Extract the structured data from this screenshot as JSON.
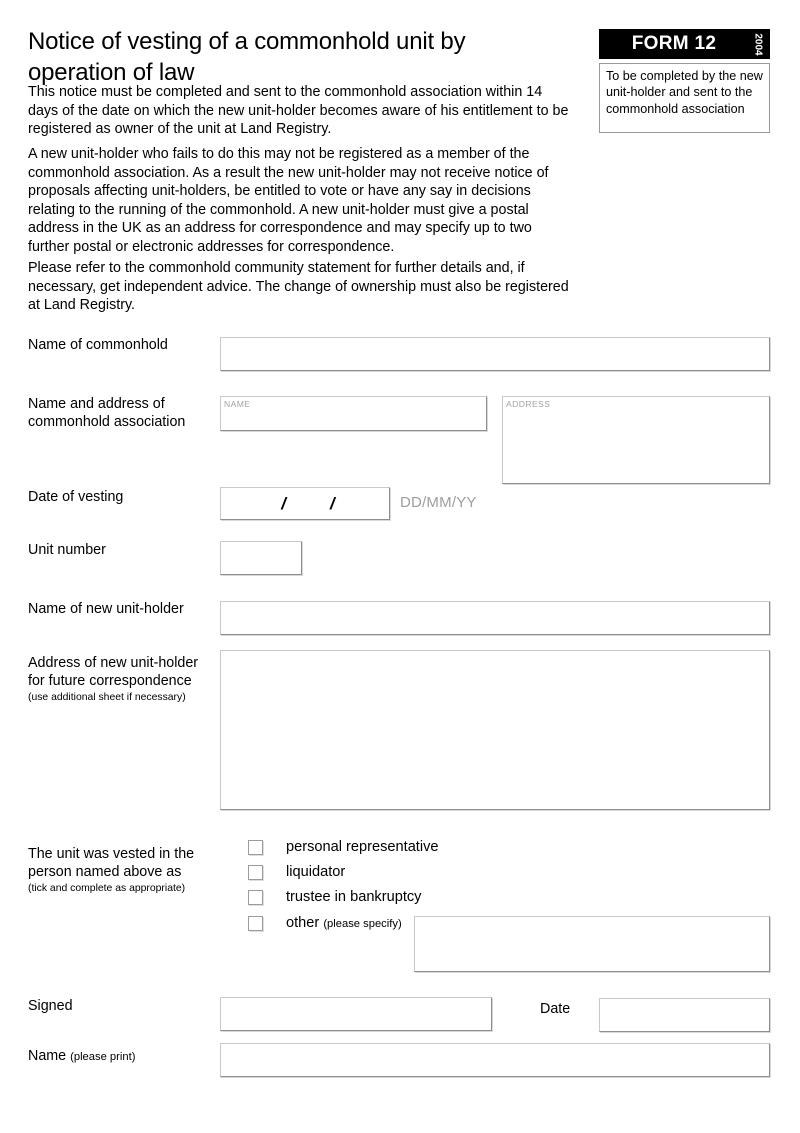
{
  "document": {
    "title": "Notice of vesting of a commonhold unit by operation of law",
    "paragraphs": [
      "This notice must be completed and sent to the commonhold association within 14 days of the date on which the new unit-holder becomes aware of his entitlement to be registered as owner of the unit at Land Registry.",
      "A new unit-holder who fails to do this may not be registered as a member of the commonhold association. As a result the new unit-holder may not receive notice of proposals affecting unit-holders, be entitled to vote or have any say in decisions relating to the running of the commonhold.  A new unit-holder must give a postal address in the UK as an address for correspondence and may specify up to two further postal or electronic addresses for correspondence.",
      "Please refer to the commonhold community statement for further details and, if necessary, get independent advice. The change of ownership must also be registered at Land Registry."
    ]
  },
  "badge": {
    "form_label": "FORM 12",
    "year": "2004",
    "note": "To be completed by the new unit-holder and sent to the commonhold association",
    "background_color": "#000000",
    "text_color": "#ffffff"
  },
  "fields": {
    "commonhold_name": {
      "label": "Name of commonhold",
      "value": ""
    },
    "association": {
      "label": "Name and address of commonhold association",
      "name_placeholder": "NAME",
      "name_value": "",
      "address_placeholder": "ADDRESS",
      "address_value": ""
    },
    "date_of_vesting": {
      "label": "Date of vesting",
      "separator": "/",
      "hint": "DD/MM/YY",
      "day": "",
      "month": "",
      "year": ""
    },
    "unit_number": {
      "label": "Unit number",
      "value": ""
    },
    "new_unit_holder_name": {
      "label": "Name of new unit-holder",
      "value": ""
    },
    "new_unit_holder_address": {
      "label": "Address of new unit-holder for future correspondence",
      "note": "(use additional sheet if necessary)",
      "value": ""
    },
    "vested_as": {
      "label": "The unit was vested in the person named above as",
      "note": "(tick and complete as appropriate)",
      "options": [
        {
          "label": "personal representative",
          "checked": false
        },
        {
          "label": "liquidator",
          "checked": false
        },
        {
          "label": "trustee in bankruptcy",
          "checked": false
        },
        {
          "label": "other",
          "note": "(please specify)",
          "checked": false
        }
      ],
      "other_value": ""
    },
    "signed": {
      "label": "Signed",
      "value": ""
    },
    "date": {
      "label": "Date",
      "value": ""
    },
    "print_name": {
      "label": "Name",
      "note": "(please print)",
      "value": ""
    }
  }
}
